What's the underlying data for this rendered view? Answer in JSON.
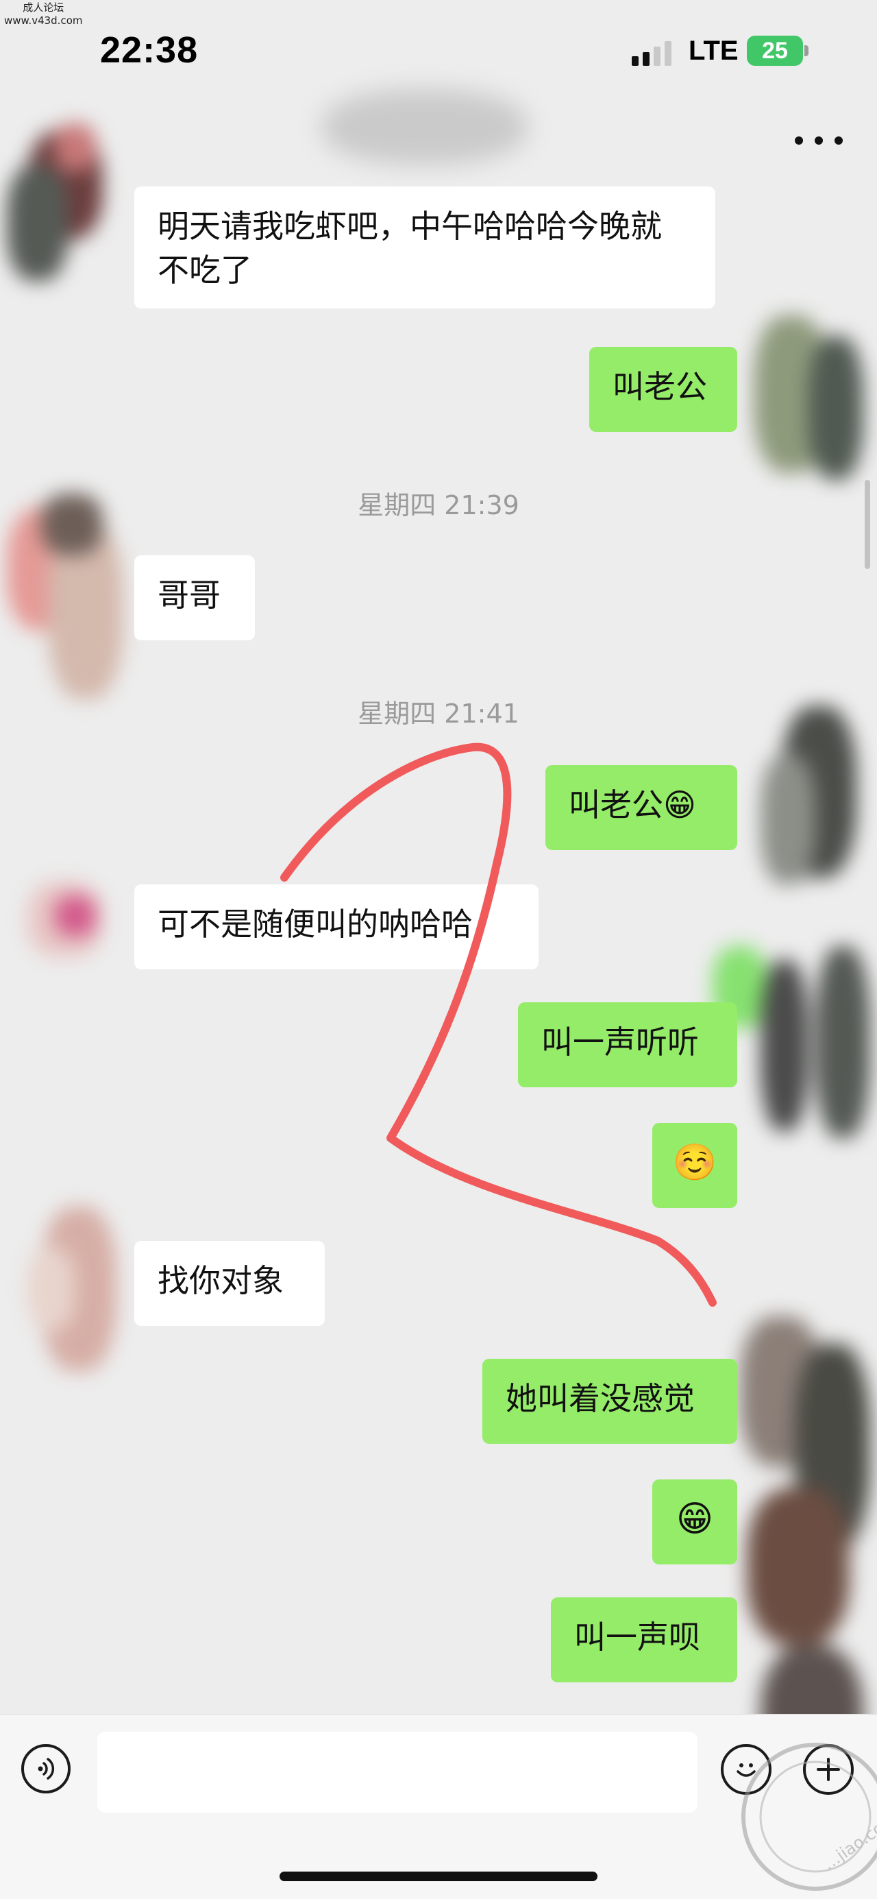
{
  "watermark": {
    "line1": "成人论坛",
    "line2": "www.v43d.com"
  },
  "status_bar": {
    "time": "22:38",
    "network": "LTE",
    "battery": "25"
  },
  "chat": {
    "messages": [
      {
        "side": "left",
        "text": "明天请我吃虾吧，中午哈哈哈今晚就不吃了"
      },
      {
        "side": "right",
        "text": "叫老公"
      },
      {
        "type": "timestamp",
        "text": "星期四 21:39"
      },
      {
        "side": "left",
        "text": "哥哥"
      },
      {
        "type": "timestamp",
        "text": "星期四 21:41"
      },
      {
        "side": "right",
        "text": "叫老公😁"
      },
      {
        "side": "left",
        "text": "可不是随便叫的呐哈哈"
      },
      {
        "side": "right",
        "text": "叫一声听听"
      },
      {
        "side": "right",
        "text": "☺️"
      },
      {
        "side": "left",
        "text": "找你对象"
      },
      {
        "side": "right",
        "text": "她叫着没感觉"
      },
      {
        "side": "right",
        "text": "😁"
      },
      {
        "side": "right",
        "text": "叫一声呗"
      }
    ]
  },
  "input_bar": {
    "placeholder": "",
    "voice_icon": "voice-icon",
    "emoji_icon": "emoji-icon",
    "plus_icon": "plus-icon"
  },
  "stamp": {
    "text": "…jiao.com"
  },
  "colors": {
    "background": "#ededed",
    "bubble_self": "#95ec69",
    "bubble_other": "#ffffff",
    "timestamp": "#9a9a9a",
    "annotation_stroke": "#f05a5a",
    "battery": "#41c768"
  }
}
